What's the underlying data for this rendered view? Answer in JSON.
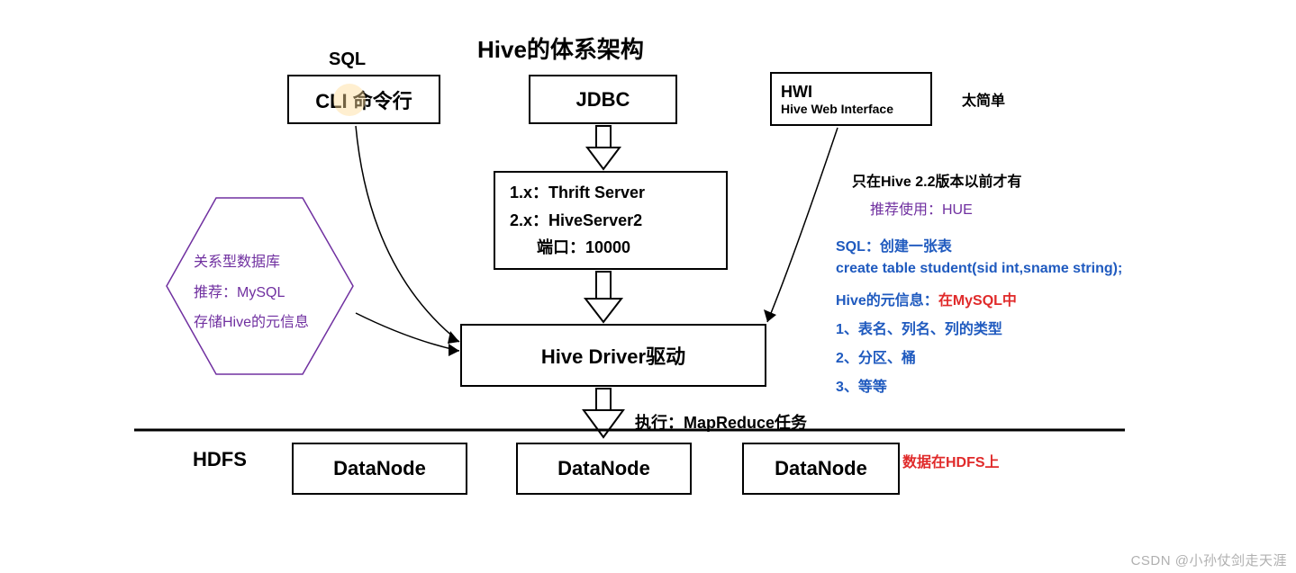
{
  "title": "Hive的体系架构",
  "sql_label": "SQL",
  "cli_box": "CLI 命令行",
  "jdbc_box": "JDBC",
  "hwi_box": {
    "line1": "HWI",
    "line2": "Hive Web Interface"
  },
  "hwi_note": "太简单",
  "server_box": {
    "line1": "1.x：Thrift Server",
    "line2": "2.x：HiveServer2",
    "line3": "端口：10000"
  },
  "driver_box": "Hive  Driver驱动",
  "hexagon": {
    "line1": "关系型数据库",
    "line2": "推荐：MySQL",
    "line3": "存储Hive的元信息"
  },
  "right_notes": {
    "n1": "只在Hive 2.2版本以前才有",
    "n2": "推荐使用：HUE",
    "n3": "SQL：创建一张表",
    "n4": "create table student(sid int,sname string);",
    "n5a": "Hive的元信息：",
    "n5b": "在MySQL中",
    "n6": "1、表名、列名、列的类型",
    "n7": "2、分区、桶",
    "n8": "3、等等"
  },
  "exec_label": "执行：MapReduce任务",
  "hdfs_label": "HDFS",
  "datanodes": [
    "DataNode",
    "DataNode",
    "DataNode"
  ],
  "hdfs_note": "数据在HDFS上",
  "watermark": "CSDN @小孙仗剑走天涯"
}
